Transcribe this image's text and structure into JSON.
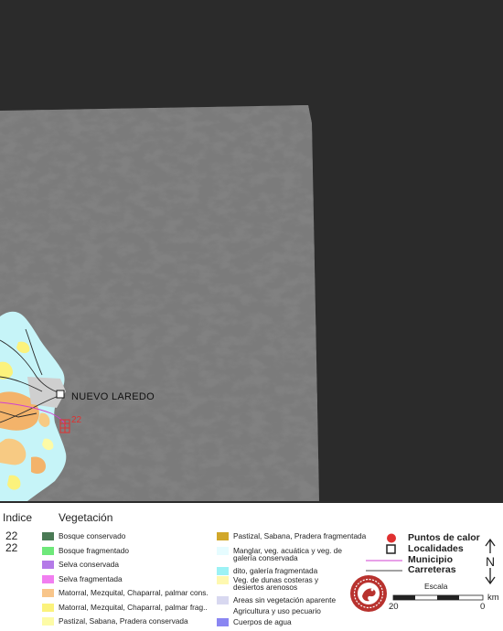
{
  "map": {
    "place_label": "NUEVO LAREDO",
    "hotspot_number": "22"
  },
  "legend": {
    "index_header": "Indice",
    "index_values": [
      "22",
      "22"
    ],
    "vegetation_header": "Vegetación",
    "vegetation_col1": [
      {
        "label": "Bosque conservado",
        "color": "#4a7a55"
      },
      {
        "label": "Bosque fragmentado",
        "color": "#6ee87a"
      },
      {
        "label": "Selva conservada",
        "color": "#b47ae8"
      },
      {
        "label": "Selva fragmentada",
        "color": "#f17ef0"
      },
      {
        "label": "Matorral, Mezquital, Chaparral, palmar cons.",
        "color": "#f8c58a"
      },
      {
        "label": "Matorral, Mezquital, Chaparral, palmar frag..",
        "color": "#fbf27c"
      },
      {
        "label": "Pastizal, Sabana, Pradera conservada",
        "color": "#fdfba6"
      }
    ],
    "vegetation_col2": [
      {
        "label": "Pastizal, Sabana, Pradera fragmentada",
        "color": "#d1a72a"
      },
      {
        "label": "Manglar, veg. acuática y veg. de galería conservada",
        "color": "#e6fcff"
      },
      {
        "label": "dito, galería fragmentada",
        "color": "#9cf2f5"
      },
      {
        "label": "Veg. de dunas costeras y desiertos arenosos",
        "color": "#fef8b0"
      },
      {
        "label": "Areas sin vegetación aparente",
        "color": "#d8d8f0"
      },
      {
        "label": "Agricultura y uso pecuario",
        "color": "#ffffff"
      },
      {
        "label": "Cuerpos de agua",
        "color": "#8a86f2"
      }
    ],
    "symbols": [
      {
        "label": "Puntos de calor",
        "icon": "red-dot-icon",
        "color": "#e03030"
      },
      {
        "label": "Localidades",
        "icon": "square-icon",
        "color": "#222222"
      },
      {
        "label": "Municipio",
        "icon": "magenta-line-icon",
        "color": "#d040d0"
      },
      {
        "label": "Carreteras",
        "icon": "black-line-icon",
        "color": "#444444"
      }
    ],
    "north_label": "N",
    "scale": {
      "title": "Escala",
      "left": "20",
      "right": "0",
      "unit": "km"
    }
  }
}
